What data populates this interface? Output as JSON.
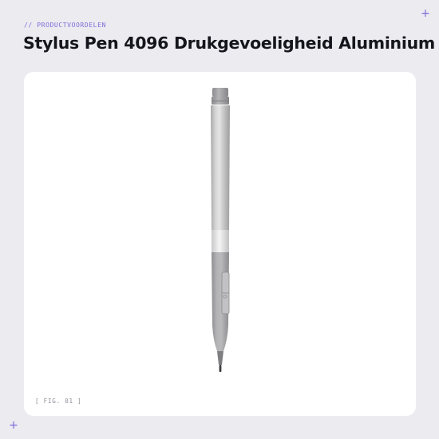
{
  "section": {
    "eyebrow": "// PRODUCTVOORDELEN",
    "title": "Stylus Pen 4096 Drukgevoeligheid Aluminium"
  },
  "figure": {
    "caption": "[ FIG. 01 ]",
    "subject": "stylus-pen"
  },
  "decorations": {
    "corner_marker": "+",
    "accent_color": "#7b6cd9"
  },
  "colors": {
    "background": "#ecebf0",
    "card": "#ffffff",
    "title": "#15151c",
    "caption": "#8e8e98",
    "pen_aluminium": "#c8c8c9",
    "pen_grip": "#a9a9ab"
  }
}
